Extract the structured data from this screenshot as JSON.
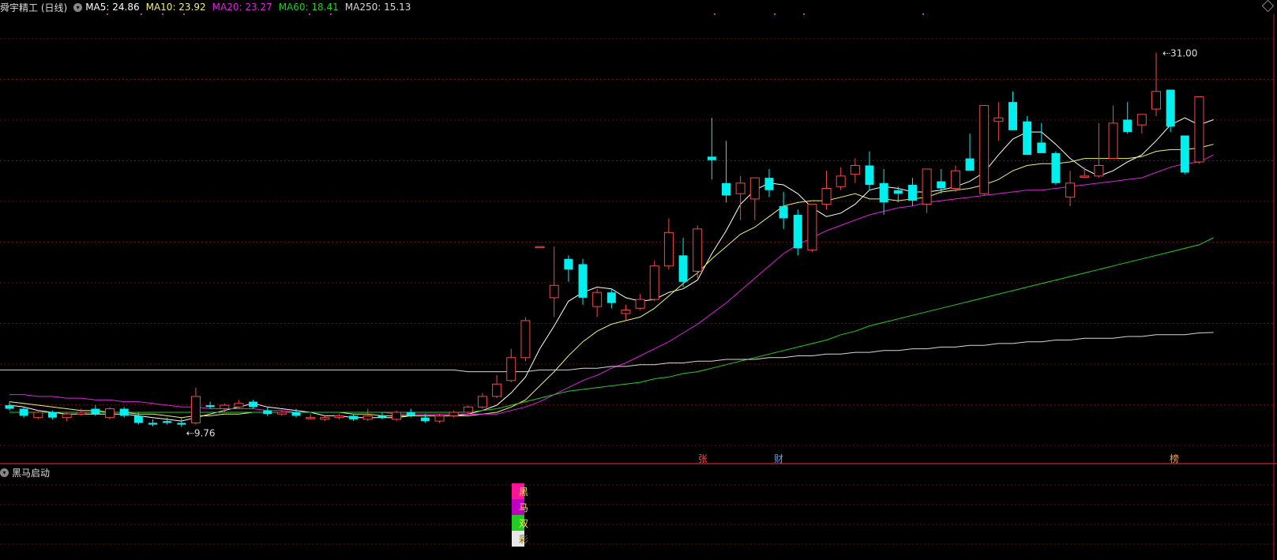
{
  "header": {
    "stock": "舜宇精工 (日线)",
    "ma5_label": "MA5: 24.86",
    "ma10_label": "MA10: 23.92",
    "ma20_label": "MA20: 23.27",
    "ma60_label": "MA60: 18.41",
    "ma250_label": "MA250: 15.13"
  },
  "indicator": {
    "title": "黑马启动"
  },
  "annotations": {
    "high_label": "31.00",
    "low_label": "9.76"
  },
  "markers": [
    "张",
    "财",
    "榜"
  ],
  "signal_chars": [
    "黑",
    "马",
    "双",
    "彩"
  ],
  "colors": {
    "bg": "#000000",
    "up": "#f04a4a",
    "down": "#00f0f0",
    "ma5": "#ffffff",
    "ma10": "#f2f26a",
    "ma20": "#e020e0",
    "ma60": "#20d020",
    "ma250": "#d8d8d8",
    "grid": "#6a1010",
    "panel_sep": "#b02020",
    "sig_magenta": "#ff1493",
    "sig_green": "#22cc22",
    "sig_white": "#e8e8e8"
  },
  "chart_data": {
    "type": "candlestick",
    "ylim": [
      8,
      33
    ],
    "high": 31.0,
    "low": 9.76,
    "ohlc": [
      [
        11.0,
        11.2,
        10.7,
        10.8
      ],
      [
        10.8,
        10.9,
        10.3,
        10.4
      ],
      [
        10.3,
        10.7,
        10.2,
        10.6
      ],
      [
        10.6,
        10.7,
        10.2,
        10.3
      ],
      [
        10.3,
        10.6,
        10.1,
        10.5
      ],
      [
        10.5,
        10.8,
        10.4,
        10.6
      ],
      [
        10.8,
        11.0,
        10.4,
        10.5
      ],
      [
        10.3,
        10.9,
        10.2,
        10.8
      ],
      [
        10.8,
        10.9,
        10.3,
        10.4
      ],
      [
        10.4,
        10.6,
        9.9,
        10.0
      ],
      [
        10.0,
        10.2,
        9.8,
        9.9
      ],
      [
        10.1,
        10.3,
        9.9,
        10.0
      ],
      [
        10.0,
        10.3,
        9.76,
        9.9
      ],
      [
        10.0,
        12.0,
        9.9,
        11.5
      ],
      [
        11.0,
        11.2,
        10.8,
        10.9
      ],
      [
        10.8,
        11.1,
        10.6,
        11.0
      ],
      [
        10.9,
        11.3,
        10.8,
        11.1
      ],
      [
        11.2,
        11.3,
        10.8,
        10.9
      ],
      [
        10.7,
        10.9,
        10.4,
        10.5
      ],
      [
        10.5,
        10.7,
        10.4,
        10.6
      ],
      [
        10.6,
        10.8,
        10.3,
        10.4
      ],
      [
        10.3,
        10.5,
        10.2,
        10.3
      ],
      [
        10.2,
        10.4,
        10.1,
        10.3
      ],
      [
        10.3,
        10.5,
        10.2,
        10.4
      ],
      [
        10.4,
        10.5,
        10.1,
        10.2
      ],
      [
        10.2,
        10.8,
        10.1,
        10.4
      ],
      [
        10.4,
        10.6,
        10.2,
        10.3
      ],
      [
        10.2,
        10.7,
        10.1,
        10.6
      ],
      [
        10.6,
        10.8,
        10.3,
        10.4
      ],
      [
        10.3,
        10.5,
        10.0,
        10.1
      ],
      [
        10.1,
        10.5,
        10.0,
        10.4
      ],
      [
        10.4,
        10.7,
        10.3,
        10.6
      ],
      [
        10.6,
        11.0,
        10.5,
        10.9
      ],
      [
        10.9,
        11.7,
        10.8,
        11.5
      ],
      [
        11.5,
        12.7,
        11.4,
        12.2
      ],
      [
        12.4,
        14.2,
        12.3,
        13.7
      ],
      [
        13.7,
        16.0,
        13.5,
        15.8
      ],
      [
        20.0,
        20.0,
        20.0,
        20.0
      ],
      [
        17.1,
        20.0,
        16.0,
        17.8
      ],
      [
        19.3,
        19.5,
        18.0,
        18.7
      ],
      [
        19.0,
        19.3,
        16.7,
        17.1
      ],
      [
        16.6,
        17.6,
        16.0,
        17.4
      ],
      [
        17.4,
        17.6,
        16.5,
        16.8
      ],
      [
        16.2,
        16.7,
        15.8,
        16.4
      ],
      [
        16.5,
        17.3,
        16.4,
        17.0
      ],
      [
        17.0,
        19.2,
        16.9,
        18.9
      ],
      [
        18.9,
        21.6,
        18.7,
        20.8
      ],
      [
        19.5,
        20.5,
        17.7,
        18.0
      ],
      [
        18.6,
        21.2,
        18.2,
        21.0
      ],
      [
        25.1,
        27.3,
        23.8,
        24.9
      ],
      [
        23.6,
        26.0,
        22.5,
        22.9
      ],
      [
        23.0,
        24.0,
        21.5,
        23.6
      ],
      [
        22.7,
        23.3,
        21.5,
        23.9
      ],
      [
        23.9,
        24.4,
        22.8,
        23.2
      ],
      [
        22.3,
        23.1,
        21.0,
        21.6
      ],
      [
        21.8,
        22.1,
        19.5,
        19.9
      ],
      [
        19.8,
        22.4,
        19.7,
        22.4
      ],
      [
        22.4,
        24.3,
        22.1,
        23.3
      ],
      [
        23.4,
        24.5,
        23.2,
        24.0
      ],
      [
        24.1,
        25.0,
        23.6,
        24.6
      ],
      [
        24.6,
        25.4,
        23.2,
        23.5
      ],
      [
        23.6,
        24.4,
        21.8,
        22.5
      ],
      [
        23.2,
        23.4,
        22.5,
        23.0
      ],
      [
        23.5,
        23.9,
        22.3,
        22.6
      ],
      [
        22.4,
        24.3,
        21.9,
        24.4
      ],
      [
        23.7,
        24.4,
        23.0,
        23.3
      ],
      [
        23.3,
        24.6,
        23.1,
        24.3
      ],
      [
        25.0,
        26.4,
        24.3,
        24.3
      ],
      [
        23.0,
        28.0,
        22.9,
        28.0
      ],
      [
        27.1,
        28.2,
        26.0,
        27.3
      ],
      [
        28.2,
        28.8,
        26.6,
        26.6
      ],
      [
        27.1,
        27.4,
        25.4,
        25.2
      ],
      [
        25.9,
        27.0,
        25.5,
        25.3
      ],
      [
        25.3,
        25.4,
        23.5,
        23.6
      ],
      [
        22.8,
        24.3,
        22.3,
        23.6
      ],
      [
        24.0,
        24.5,
        23.9,
        24.0
      ],
      [
        24.0,
        27.0,
        23.9,
        24.6
      ],
      [
        25.0,
        28.0,
        25.3,
        27.0
      ],
      [
        27.2,
        28.2,
        26.4,
        26.5
      ],
      [
        26.9,
        27.3,
        26.4,
        27.5
      ],
      [
        27.8,
        31.0,
        27.4,
        28.8
      ],
      [
        28.9,
        28.2,
        26.5,
        26.8
      ],
      [
        26.3,
        24.7,
        24.1,
        24.2
      ],
      [
        24.8,
        28.5,
        24.7,
        28.5
      ]
    ],
    "ma": {
      "ma5": [
        11.0,
        10.9,
        10.7,
        10.6,
        10.5,
        10.5,
        10.5,
        10.5,
        10.5,
        10.4,
        10.3,
        10.2,
        10.1,
        10.3,
        10.5,
        10.7,
        10.9,
        11.1,
        10.9,
        10.8,
        10.7,
        10.6,
        10.4,
        10.4,
        10.3,
        10.3,
        10.3,
        10.3,
        10.4,
        10.4,
        10.4,
        10.4,
        10.5,
        10.7,
        11.0,
        11.7,
        12.6,
        14.2,
        15.5,
        16.9,
        17.4,
        17.7,
        17.6,
        17.1,
        16.9,
        17.0,
        17.4,
        17.6,
        18.1,
        19.6,
        20.9,
        22.4,
        23.2,
        23.6,
        23.5,
        23.0,
        22.2,
        21.7,
        21.9,
        22.4,
        23.2,
        23.4,
        23.3,
        23.1,
        23.1,
        23.2,
        23.4,
        23.7,
        24.2,
        25.2,
        26.1,
        26.5,
        26.5,
        25.8,
        25.0,
        24.4,
        24.0,
        24.3,
        24.8,
        25.2,
        26.0,
        26.9,
        27.3,
        26.9,
        27.2
      ],
      "ma10": [
        11.2,
        11.1,
        11.0,
        10.9,
        10.8,
        10.7,
        10.7,
        10.6,
        10.6,
        10.5,
        10.5,
        10.4,
        10.3,
        10.4,
        10.4,
        10.5,
        10.5,
        10.6,
        10.6,
        10.6,
        10.6,
        10.6,
        10.6,
        10.6,
        10.5,
        10.5,
        10.4,
        10.4,
        10.4,
        10.4,
        10.4,
        10.4,
        10.4,
        10.5,
        10.6,
        10.9,
        11.3,
        12.1,
        12.9,
        13.8,
        14.6,
        15.2,
        15.6,
        15.8,
        16.0,
        16.5,
        17.2,
        17.9,
        18.5,
        19.3,
        20.0,
        20.7,
        21.1,
        21.7,
        22.3,
        22.5,
        22.6,
        22.6,
        22.8,
        23.0,
        22.7,
        22.7,
        22.6,
        22.7,
        22.8,
        23.1,
        23.2,
        23.3,
        23.5,
        23.8,
        24.3,
        24.6,
        24.7,
        24.7,
        24.8,
        25.0,
        25.0,
        25.0,
        25.0,
        25.1,
        25.4,
        25.5,
        25.5,
        25.6,
        25.8
      ],
      "ma20": [
        11.6,
        11.6,
        11.5,
        11.5,
        11.4,
        11.4,
        11.3,
        11.3,
        11.2,
        11.2,
        11.1,
        11.0,
        10.9,
        10.9,
        10.8,
        10.8,
        10.8,
        10.8,
        10.7,
        10.7,
        10.6,
        10.6,
        10.6,
        10.6,
        10.6,
        10.6,
        10.6,
        10.5,
        10.5,
        10.5,
        10.5,
        10.5,
        10.5,
        10.5,
        10.5,
        10.7,
        10.9,
        11.2,
        11.6,
        12.0,
        12.4,
        12.7,
        13.1,
        13.4,
        13.8,
        14.2,
        14.6,
        15.1,
        15.6,
        16.2,
        16.8,
        17.5,
        18.2,
        18.9,
        19.6,
        20.1,
        20.5,
        20.9,
        21.2,
        21.5,
        21.8,
        22.0,
        22.2,
        22.3,
        22.5,
        22.6,
        22.7,
        22.8,
        22.9,
        23.0,
        23.1,
        23.2,
        23.2,
        23.3,
        23.4,
        23.5,
        23.6,
        23.7,
        23.8,
        23.9,
        24.2,
        24.5,
        24.7,
        24.8,
        25.2
      ],
      "ma60": [
        10.6,
        10.6,
        10.6,
        10.6,
        10.6,
        10.6,
        10.6,
        10.6,
        10.6,
        10.6,
        10.6,
        10.6,
        10.6,
        10.6,
        10.6,
        10.6,
        10.6,
        10.6,
        10.6,
        10.6,
        10.6,
        10.6,
        10.6,
        10.6,
        10.6,
        10.6,
        10.6,
        10.6,
        10.6,
        10.6,
        10.6,
        10.6,
        10.6,
        10.7,
        10.8,
        11.0,
        11.2,
        11.4,
        11.6,
        11.8,
        11.9,
        12.0,
        12.1,
        12.2,
        12.3,
        12.5,
        12.6,
        12.8,
        12.9,
        13.1,
        13.3,
        13.5,
        13.7,
        13.9,
        14.1,
        14.3,
        14.5,
        14.7,
        15.0,
        15.2,
        15.5,
        15.7,
        15.9,
        16.1,
        16.3,
        16.5,
        16.7,
        16.9,
        17.1,
        17.3,
        17.5,
        17.7,
        17.9,
        18.1,
        18.3,
        18.5,
        18.7,
        18.9,
        19.1,
        19.3,
        19.5,
        19.7,
        19.9,
        20.1,
        20.5
      ],
      "ma250": [
        13.0,
        13.0,
        13.0,
        13.0,
        13.0,
        13.0,
        13.0,
        13.0,
        13.0,
        13.0,
        13.0,
        13.0,
        13.0,
        13.0,
        13.0,
        13.0,
        13.0,
        13.0,
        13.0,
        13.0,
        13.0,
        13.0,
        13.0,
        13.0,
        13.0,
        13.0,
        13.0,
        13.0,
        13.0,
        13.0,
        13.0,
        13.0,
        12.9,
        12.9,
        12.9,
        12.9,
        12.9,
        13.0,
        13.0,
        13.0,
        13.1,
        13.1,
        13.2,
        13.2,
        13.3,
        13.3,
        13.4,
        13.4,
        13.5,
        13.5,
        13.6,
        13.6,
        13.6,
        13.7,
        13.7,
        13.8,
        13.8,
        13.9,
        13.9,
        14.0,
        14.0,
        14.1,
        14.1,
        14.2,
        14.2,
        14.3,
        14.3,
        14.4,
        14.4,
        14.5,
        14.5,
        14.6,
        14.6,
        14.7,
        14.7,
        14.8,
        14.8,
        14.8,
        14.9,
        14.9,
        15.0,
        15.0,
        15.0,
        15.1,
        15.13
      ]
    },
    "signal_index": 33
  }
}
